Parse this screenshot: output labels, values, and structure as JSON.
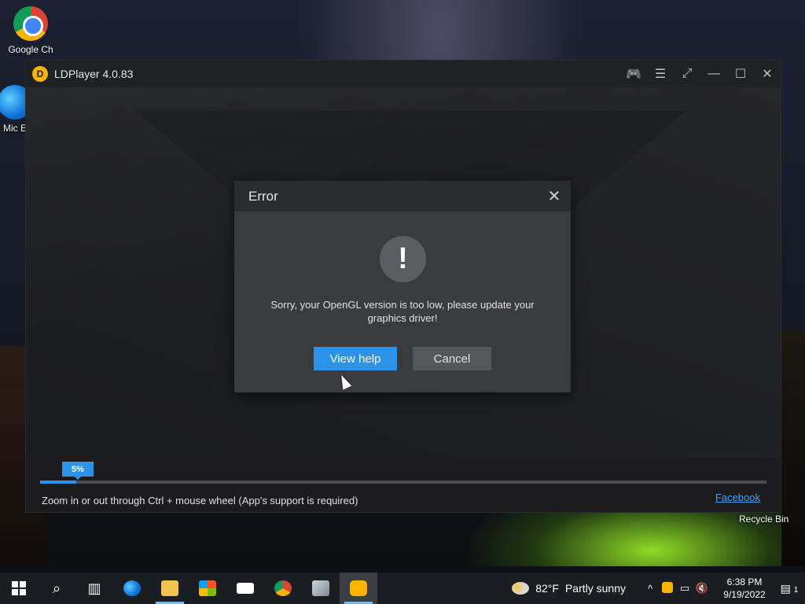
{
  "desktop": {
    "icons": [
      {
        "label": "Google Ch"
      },
      {
        "label": "Mic E"
      }
    ],
    "recycle_bin": "Recycle Bin"
  },
  "window": {
    "title": "LDPlayer 4.0.83",
    "logo_glyph": "D",
    "controls": {
      "gamepad": "🎮",
      "menu": "☰",
      "resize": "⤢",
      "minimize": "—",
      "maximize": "☐",
      "close": "✕"
    }
  },
  "dialog": {
    "title": "Error",
    "close_glyph": "✕",
    "alert_glyph": "!",
    "message": "Sorry, your OpenGL version is too low, please update your graphics driver!",
    "primary_button": "View help",
    "secondary_button": "Cancel"
  },
  "loader": {
    "progress_label": "5%",
    "progress": 0.05,
    "tip": "Zoom in or out through Ctrl + mouse wheel (App's support is required)",
    "link": "Facebook"
  },
  "taskbar": {
    "weather_temp": "82°F",
    "weather_text": "Partly sunny",
    "time": "6:38 PM",
    "date": "9/19/2022",
    "notification_count": "1",
    "tray_chevron": "^",
    "colors": {
      "accent": "#2d93e8",
      "taskbar": "#1a1d22"
    }
  }
}
